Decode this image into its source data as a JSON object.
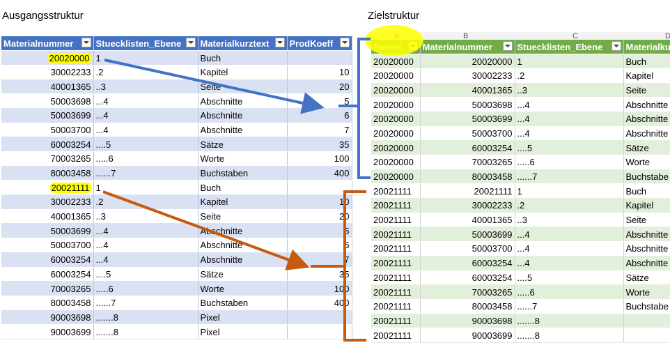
{
  "titles": {
    "left": "Ausgangsstruktur",
    "right": "Zielstruktur"
  },
  "right_col_letters": [
    "A",
    "B",
    "C",
    "D"
  ],
  "left_table": {
    "headers": [
      "Materialnummer",
      "Stuecklisten_Ebene",
      "Materialkurztext",
      "ProdKoeff"
    ],
    "rows": [
      [
        "20020000",
        "1",
        "Buch",
        ""
      ],
      [
        "30002233",
        ".2",
        "Kapitel",
        "10"
      ],
      [
        "40001365",
        "..3",
        "Seite",
        "20"
      ],
      [
        "50003698",
        "...4",
        "Abschnitte",
        "5"
      ],
      [
        "50003699",
        "...4",
        "Abschnitte",
        "6"
      ],
      [
        "50003700",
        "...4",
        "Abschnitte",
        "7"
      ],
      [
        "60003254",
        "....5",
        "Sätze",
        "35"
      ],
      [
        "70003265",
        ".....6",
        "Worte",
        "100"
      ],
      [
        "80003458",
        "......7",
        "Buchstaben",
        "400"
      ],
      [
        "20021111",
        "1",
        "Buch",
        ""
      ],
      [
        "30002233",
        ".2",
        "Kapitel",
        "10"
      ],
      [
        "40001365",
        "..3",
        "Seite",
        "20"
      ],
      [
        "50003699",
        "...4",
        "Abschnitte",
        "5"
      ],
      [
        "50003700",
        "...4",
        "Abschnitte",
        "6"
      ],
      [
        "60003254",
        "...4",
        "Abschnitte",
        "7"
      ],
      [
        "60003254",
        "....5",
        "Sätze",
        "35"
      ],
      [
        "70003265",
        ".....6",
        "Worte",
        "100"
      ],
      [
        "80003458",
        "......7",
        "Buchstaben",
        "400"
      ],
      [
        "90003698",
        ".......8",
        "Pixel",
        ""
      ],
      [
        "90003699",
        ".......8",
        "Pixel",
        ""
      ]
    ]
  },
  "right_table": {
    "headers": [
      "Parent",
      "Materialnummer",
      "Stuecklisten_Ebene",
      "Materialku"
    ],
    "rows": [
      [
        "20020000",
        "20020000",
        "1",
        "Buch"
      ],
      [
        "20020000",
        "30002233",
        ".2",
        "Kapitel"
      ],
      [
        "20020000",
        "40001365",
        "..3",
        "Seite"
      ],
      [
        "20020000",
        "50003698",
        "...4",
        "Abschnitte"
      ],
      [
        "20020000",
        "50003699",
        "...4",
        "Abschnitte"
      ],
      [
        "20020000",
        "50003700",
        "...4",
        "Abschnitte"
      ],
      [
        "20020000",
        "60003254",
        "....5",
        "Sätze"
      ],
      [
        "20020000",
        "70003265",
        ".....6",
        "Worte"
      ],
      [
        "20020000",
        "80003458",
        "......7",
        "Buchstabe"
      ],
      [
        "20021111",
        "20021111",
        "1",
        "Buch"
      ],
      [
        "20021111",
        "30002233",
        ".2",
        "Kapitel"
      ],
      [
        "20021111",
        "40001365",
        "..3",
        "Seite"
      ],
      [
        "20021111",
        "50003699",
        "...4",
        "Abschnitte"
      ],
      [
        "20021111",
        "50003700",
        "...4",
        "Abschnitte"
      ],
      [
        "20021111",
        "60003254",
        "...4",
        "Abschnitte"
      ],
      [
        "20021111",
        "60003254",
        "....5",
        "Sätze"
      ],
      [
        "20021111",
        "70003265",
        ".....6",
        "Worte"
      ],
      [
        "20021111",
        "80003458",
        "......7",
        "Buchstabe"
      ],
      [
        "20021111",
        "90003698",
        ".......8",
        ""
      ],
      [
        "20021111",
        "90003699",
        ".......8",
        ""
      ]
    ]
  },
  "colors": {
    "blue_arrow": "#4472c4",
    "orange_arrow": "#c55a11",
    "highlight": "#ffff00"
  }
}
